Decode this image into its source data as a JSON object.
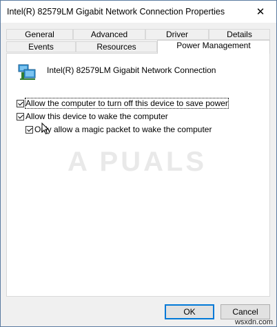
{
  "window": {
    "title": "Intel(R) 82579LM Gigabit Network Connection Properties",
    "close_glyph": "✕"
  },
  "tabs_row1": [
    "General",
    "Advanced",
    "Driver",
    "Details"
  ],
  "tabs_row2": [
    "Events",
    "Resources",
    "Power Management"
  ],
  "device": {
    "name": "Intel(R) 82579LM Gigabit Network Connection",
    "icon": "network-adapter-icon"
  },
  "options": [
    {
      "label": "Allow the computer to turn off this device to save power",
      "checked": true
    },
    {
      "label": "Allow this device to wake the computer",
      "checked": true
    },
    {
      "label": "Only allow a magic packet to wake the computer",
      "checked": true
    }
  ],
  "watermark": "A PUALS",
  "buttons": {
    "ok": "OK",
    "cancel": "Cancel"
  },
  "source_tag": "wsxdn.com",
  "colors": {
    "focus_border": "#0078d7",
    "window_bg": "#f0f0f0"
  }
}
